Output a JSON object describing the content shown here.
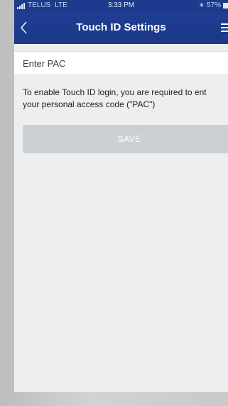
{
  "status_bar": {
    "carrier": "TELUS",
    "network": "LTE",
    "time": "3:33 PM",
    "bluetooth_icon": "bluetooth-icon",
    "battery": "57%"
  },
  "nav": {
    "back_icon": "chevron-left-icon",
    "title": "Touch ID Settings",
    "menu_icon": "hamburger-menu-icon"
  },
  "form": {
    "pac_placeholder": "Enter PAC",
    "pac_value": "",
    "info_line1": "To enable Touch ID login, you are required to ent",
    "info_line2": "your personal access code (\"PAC\")",
    "save_label": "SAVE"
  },
  "colors": {
    "nav_bar": "#1d3b8c",
    "background": "#eceeef",
    "save_disabled": "#cdd0d3"
  }
}
